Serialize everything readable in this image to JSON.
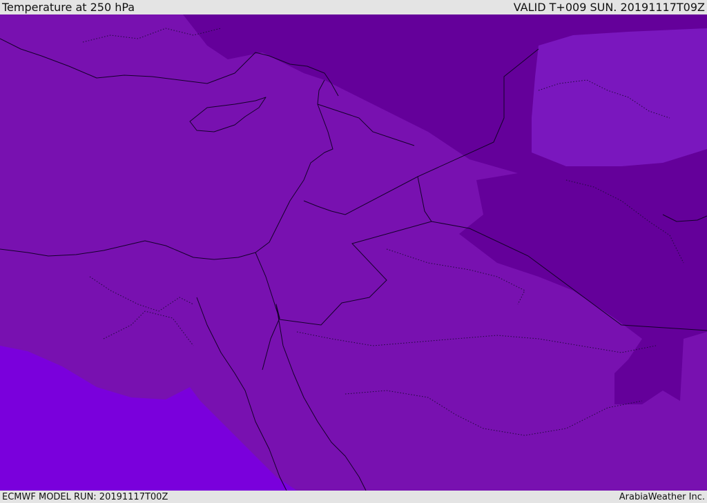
{
  "header": {
    "title": "Temperature at 250 hPa",
    "valid": "VALID T+009 SUN. 20191117T09Z"
  },
  "footer": {
    "model_run": "ECMWF MODEL RUN: 20191117T00Z",
    "credit": "ArabiaWeather Inc."
  },
  "colors": {
    "field_main": "#7811b0",
    "field_cold": "#64009a",
    "field_warm": "#7a00dc",
    "field_mid": "#7a17be",
    "lines": "#14002a"
  }
}
